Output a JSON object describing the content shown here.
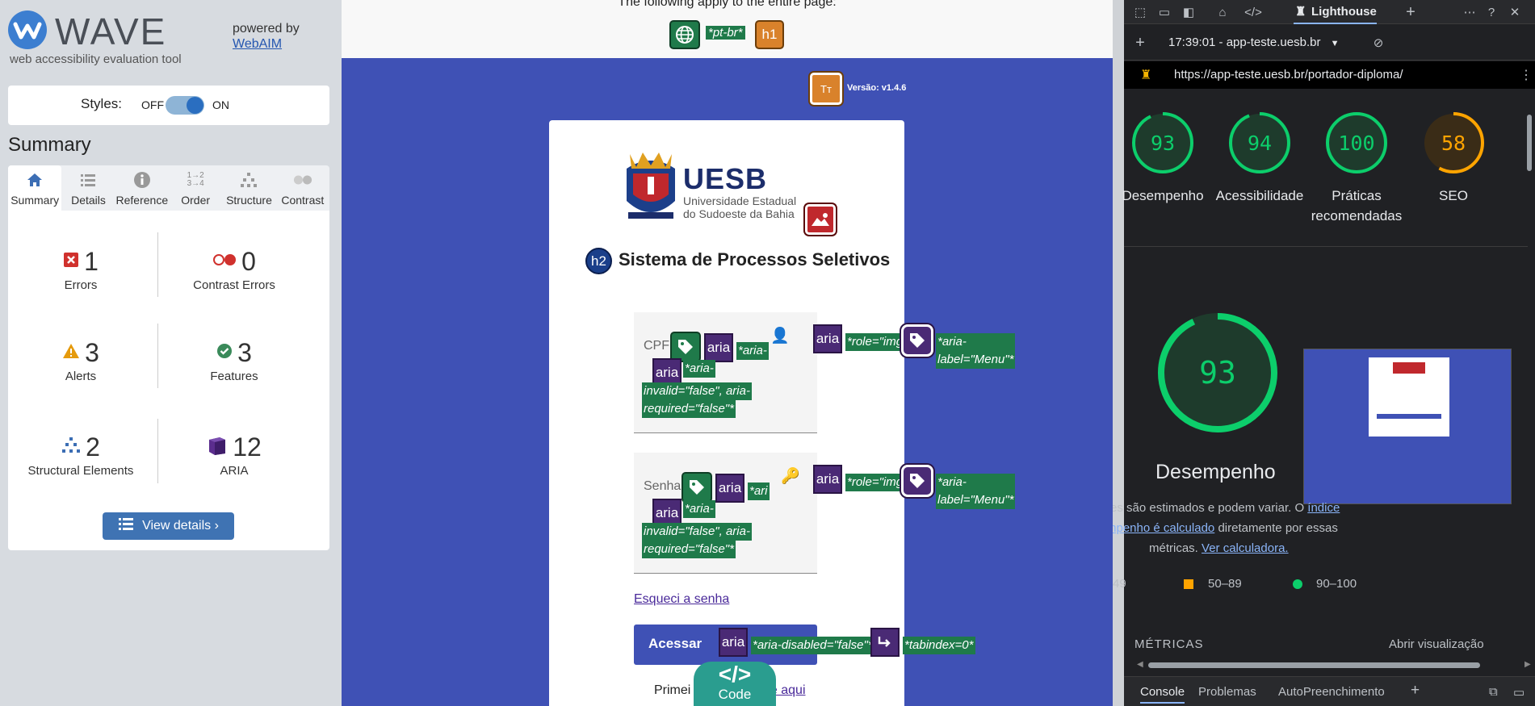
{
  "wave": {
    "logo_text": "WAVE",
    "tagline": "web accessibility evaluation tool",
    "powered_by": "powered by",
    "webaim_link": "WebAIM",
    "styles_label": "Styles:",
    "styles_off": "OFF",
    "styles_on": "ON",
    "summary_title": "Summary",
    "tabs": [
      {
        "label": "Summary"
      },
      {
        "label": "Details"
      },
      {
        "label": "Reference"
      },
      {
        "label": "Order"
      },
      {
        "label": "Structure"
      },
      {
        "label": "Contrast"
      }
    ],
    "stats": {
      "errors": {
        "count": "1",
        "label": "Errors"
      },
      "contrast": {
        "count": "0",
        "label": "Contrast Errors"
      },
      "alerts": {
        "count": "3",
        "label": "Alerts"
      },
      "features": {
        "count": "3",
        "label": "Features"
      },
      "structural": {
        "count": "2",
        "label": "Structural Elements"
      },
      "aria": {
        "count": "12",
        "label": "ARIA"
      }
    },
    "view_details": "View details ›"
  },
  "page": {
    "applies_text": "The following apply to the entire page:",
    "lang_tag": "*pt-br*",
    "h1_badge": "h1",
    "version_text": "Versão: v1.4.6",
    "uesb_name": "UESB",
    "uesb_sub1": "Universidade Estadual",
    "uesb_sub2": "do Sudoeste da Bahia",
    "h2_badge": "h2",
    "system_title": "Sistema de Processos Seletivos",
    "cpf_label": "CPF",
    "senha_label": "Senha",
    "aria_badge": "aria",
    "aria_short1": "*aria-",
    "aria_short2": "*ari",
    "aria_piece": "*aria-",
    "aria_invalid": "invalid=\"false\", aria-",
    "aria_required": "required=\"false\"*",
    "role_img": "*role=\"img\"*",
    "aria_label_menu": "*aria-label=\"Menu\"*",
    "forgot_password": "Esqueci a senha",
    "acessar_button": "Acessar",
    "aria_disabled": "*aria-disabled=\"false\"*",
    "tabindex": "*tabindex=0*",
    "primeiro_text": "Primei",
    "primeiro_link": "ue aqui",
    "code_label": "Code",
    "code_symbol": "</>"
  },
  "devtools": {
    "lighthouse_tab": "Lighthouse",
    "timestamp_label": "17:39:01 - app-teste.uesb.br",
    "url": "https://app-teste.uesb.br/portador-diploma/",
    "scores": [
      {
        "value": 93,
        "label": "Desempenho",
        "color": "#0cce6b"
      },
      {
        "value": 94,
        "label": "Acessibilidade",
        "color": "#0cce6b"
      },
      {
        "value": 100,
        "label": "Práticas recomendadas",
        "color": "#0cce6b"
      },
      {
        "value": 58,
        "label": "SEO",
        "color": "#ffa400"
      }
    ],
    "big_score": "93",
    "big_label": "Desempenho",
    "desc_1": "res são estimados e podem variar. O",
    "desc_link1": "índice",
    "desc_link2": "mpenho é calculado",
    "desc_2": "diretamente por essas",
    "desc_3": "métricas.",
    "desc_link3": "Ver calculadora.",
    "legend_low": "49",
    "legend_mid": "50–89",
    "legend_high": "90–100",
    "metrics_title": "MÉTRICAS",
    "open_view": "Abrir visualização",
    "bottom_tabs": [
      "Console",
      "Problemas",
      "AutoPreenchimento"
    ]
  },
  "colors": {
    "page_bg": "#3f51b5",
    "score_good": "#0cce6b",
    "score_average": "#ffa400",
    "wave_error": "#d0312d",
    "wave_alert": "#e59a0c",
    "aria_purple": "#4a2a75",
    "feature_green": "#1f7a4a"
  }
}
